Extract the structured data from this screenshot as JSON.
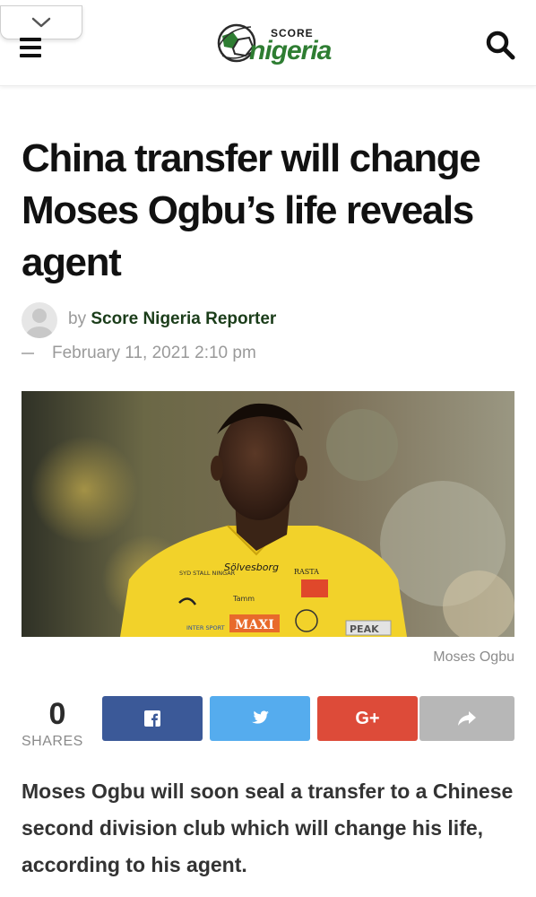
{
  "header": {
    "logo_top": "SCORE",
    "logo_bottom": "nigeria"
  },
  "article": {
    "title": "China transfer will change Moses Ogbu’s life reveals agent",
    "byline_prefix": "by",
    "author": "Score Nigeria Reporter",
    "date": "February 11, 2021 2:10 pm",
    "image_caption": "Moses Ogbu",
    "lead": "Moses Ogbu will soon seal a transfer to a Chinese second division club which will change his life, according to his agent."
  },
  "share": {
    "count": "0",
    "label": "SHARES",
    "buttons": [
      {
        "network": "facebook",
        "icon": "facebook-icon",
        "color": "#3b5998"
      },
      {
        "network": "twitter",
        "icon": "twitter-icon",
        "color": "#55acee"
      },
      {
        "network": "google-plus",
        "icon": "google-plus-icon",
        "label": "G+",
        "color": "#dd4b39"
      },
      {
        "network": "more",
        "icon": "share-arrow-icon",
        "color": "#b7b7b7"
      }
    ]
  },
  "jersey_text": {
    "sponsor_1": "Sölvesborg",
    "sponsor_2": "RASTA",
    "sponsor_3": "SYD STALL NINGAR",
    "sponsor_4": "MAXI",
    "sponsor_5": "Tamm",
    "sponsor_6": "INTER SPORT",
    "sponsor_7": "PEAK"
  },
  "colors": {
    "brand_green": "#2e7d32",
    "author_color": "#1b3d1a",
    "jersey_yellow": "#f2d22a"
  }
}
